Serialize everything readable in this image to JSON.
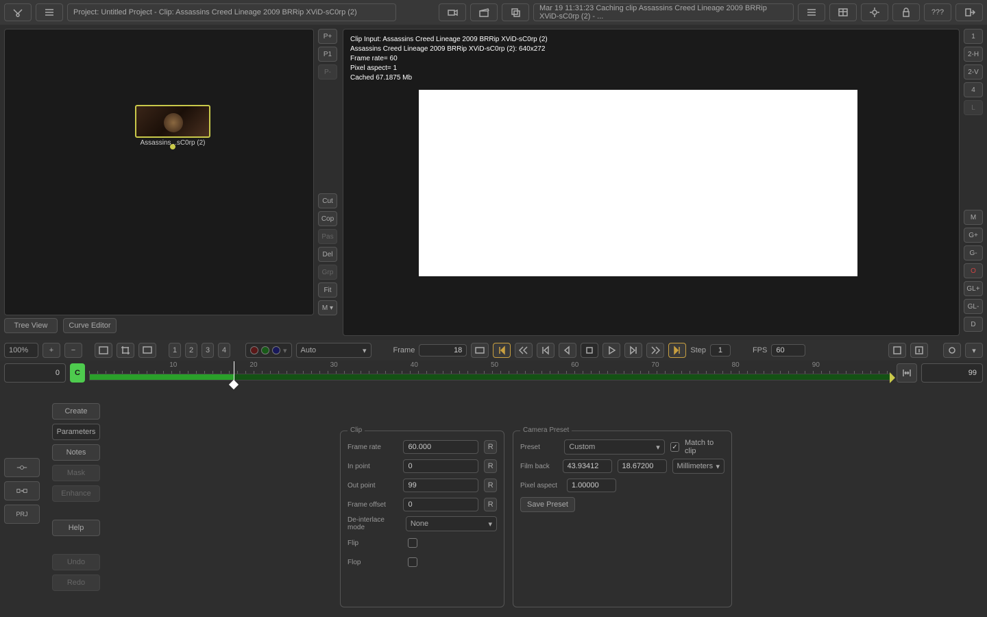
{
  "topbar": {
    "project_title": "Project: Untitled Project - Clip: Assassins Creed Lineage 2009 BRRip XViD-sC0rp (2)",
    "status": "Mar 19 11:31:23 Caching clip Assassins Creed Lineage 2009 BRRip XViD-sC0rp (2) - ...",
    "help_label": "???"
  },
  "tree": {
    "node_label": "Assassins ..sC0rp (2)",
    "tabs": {
      "tree": "Tree View",
      "curve": "Curve Editor"
    },
    "side": {
      "p_plus": "P+",
      "p1": "P1",
      "p_minus": "P-",
      "cut": "Cut",
      "cop": "Cop",
      "pas": "Pas",
      "del": "Del",
      "grp": "Grp",
      "fit": "Fit",
      "m": "M ▾"
    }
  },
  "viewer": {
    "info": {
      "l1": "Clip Input: Assassins Creed Lineage 2009 BRRip XViD-sC0rp (2)",
      "l2": "Assassins Creed Lineage 2009 BRRip XViD-sC0rp (2): 640x272",
      "l3": "Frame rate= 60",
      "l4": "Pixel aspect= 1",
      "l5": "Cached 67.1875 Mb"
    },
    "side": {
      "one": "1",
      "two_h": "2-H",
      "two_v": "2-V",
      "four": "4",
      "l": "L",
      "m": "M",
      "g_plus": "G+",
      "g_minus": "G-",
      "o": "O",
      "gl_plus": "GL+",
      "gl_minus": "GL-",
      "d": "D"
    }
  },
  "transport": {
    "zoom": "100%",
    "preset": "Auto",
    "nums": {
      "n1": "1",
      "n2": "2",
      "n3": "3",
      "n4": "4"
    },
    "frame_label": "Frame",
    "frame_value": "18",
    "step_label": "Step",
    "step_value": "1",
    "fps_label": "FPS",
    "fps_value": "60"
  },
  "timeline": {
    "start": "0",
    "end": "99",
    "cache": "C",
    "ticks": [
      "10",
      "20",
      "30",
      "40",
      "50",
      "60",
      "70",
      "80",
      "90"
    ]
  },
  "bottom": {
    "left": {
      "create": "Create",
      "parameters": "Parameters",
      "notes": "Notes",
      "mask": "Mask",
      "enhance": "Enhance",
      "help": "Help",
      "undo": "Undo",
      "redo": "Redo"
    },
    "icons": {
      "prj": "PRJ"
    },
    "clip": {
      "legend": "Clip",
      "frame_rate_l": "Frame rate",
      "frame_rate": "60.000",
      "in_point_l": "In point",
      "in_point": "0",
      "out_point_l": "Out point",
      "out_point": "99",
      "frame_offset_l": "Frame offset",
      "frame_offset": "0",
      "deinterlace_l": "De-interlace mode",
      "deinterlace": "None",
      "flip_l": "Flip",
      "flop_l": "Flop",
      "r": "R"
    },
    "cam": {
      "legend": "Camera Preset",
      "preset_l": "Preset",
      "preset": "Custom",
      "match": "Match to clip",
      "filmback_l": "Film back",
      "filmback_w": "43.93412",
      "filmback_h": "18.67200",
      "unit": "Millimeters",
      "pixel_l": "Pixel aspect",
      "pixel": "1.00000",
      "save": "Save Preset"
    }
  }
}
